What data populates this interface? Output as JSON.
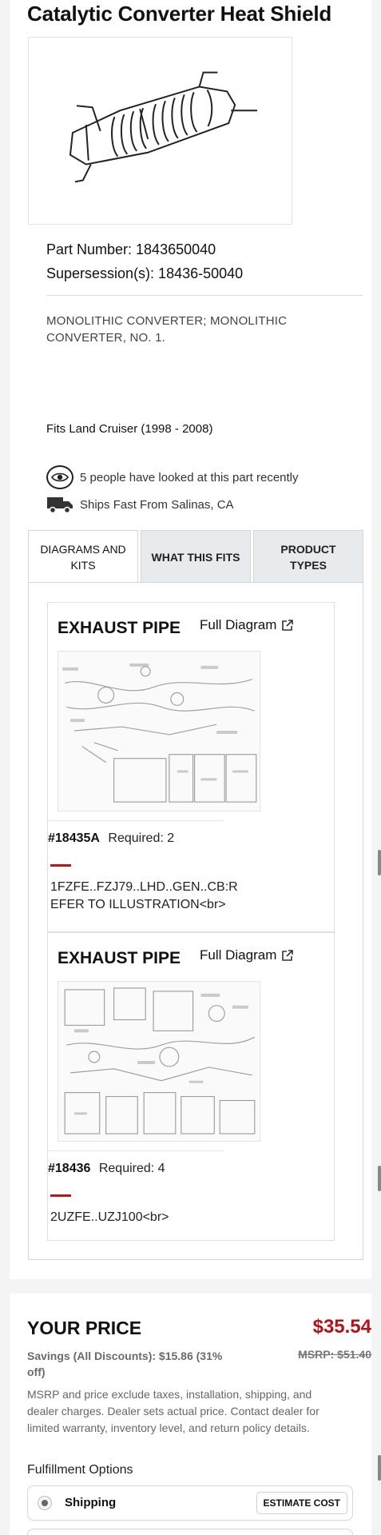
{
  "product": {
    "title": "Catalytic Converter Heat Shield",
    "part_number": "Part Number: 1843650040",
    "supersession": "Supersession(s): 18436-50040",
    "description": "MONOLITHIC CONVERTER; MONOLITHIC CONVERTER, NO. 1.",
    "fits": "Fits Land Cruiser (1998 - 2008)"
  },
  "info": {
    "views_text": "5 people have looked at this part recently",
    "ships_text": "Ships Fast From Salinas, CA",
    "icons": [
      "eye-icon",
      "truck-icon"
    ]
  },
  "tabs": [
    {
      "label": "DIAGRAMS AND KITS",
      "active": true
    },
    {
      "label": "WHAT THIS FITS",
      "active": false
    },
    {
      "label": "PRODUCT TYPES",
      "active": false
    }
  ],
  "diagrams": [
    {
      "title": "EXHAUST PIPE",
      "link": "Full Diagram",
      "ref": "#18435A",
      "required": "Required: 2",
      "note": "1FZFE..FZJ79..LHD..GEN..CB:REFER TO ILLUSTRATION<br>"
    },
    {
      "title": "EXHAUST PIPE",
      "link": "Full Diagram",
      "ref": "#18436",
      "required": "Required: 4",
      "note": "2UZFE..UZJ100<br>"
    }
  ],
  "pricing": {
    "label": "YOUR PRICE",
    "price": "$35.54",
    "savings": "Savings (All Discounts): $15.86 (31% off)",
    "msrp": "MSRP: $51.40",
    "disclaimer": "MSRP and price exclude taxes, installation, shipping, and dealer charges. Dealer sets actual price. Contact dealer for limited warranty, inventory level, and return policy details."
  },
  "fulfillment": {
    "title": "Fulfillment Options",
    "shipping_label": "Shipping",
    "estimate_button": "ESTIMATE COST"
  },
  "colors": {
    "accent_red": "#b3121a",
    "tab_inactive": "#e8ebee"
  }
}
